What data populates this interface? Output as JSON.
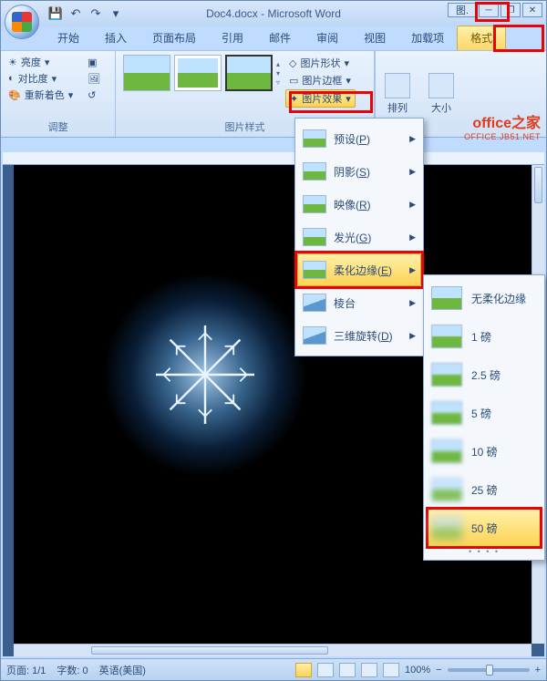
{
  "titlebar": {
    "doc_title": "Doc4.docx - Microsoft Word",
    "context_tab": "图."
  },
  "tabs": [
    "开始",
    "插入",
    "页面布局",
    "引用",
    "邮件",
    "审阅",
    "视图",
    "加载项",
    "格式"
  ],
  "ribbon": {
    "adjust": {
      "brightness": "亮度",
      "contrast": "对比度",
      "recolor": "重新着色",
      "label": "调整"
    },
    "styles": {
      "shape": "图片形状",
      "border": "图片边框",
      "effects": "图片效果",
      "label": "图片样式"
    },
    "arrange": {
      "label": "排列"
    },
    "size": {
      "label": "大小"
    }
  },
  "fx_menu": {
    "preset": "预设(P)",
    "shadow": "阴影(S)",
    "reflection": "映像(R)",
    "glow": "发光(G)",
    "softedge": "柔化边缘(E)",
    "bevel": "棱台",
    "rotation3d": "三维旋转(D)"
  },
  "soft_menu": {
    "none": "无柔化边缘",
    "p1": "1 磅",
    "p25": "2.5 磅",
    "p5": "5 磅",
    "p10": "10 磅",
    "p25b": "25 磅",
    "p50": "50 磅"
  },
  "watermark": {
    "line1": "office之家",
    "line2": "OFFICE.JB51.NET"
  },
  "statusbar": {
    "page": "页面: 1/1",
    "words": "字数: 0",
    "lang": "英语(美国)",
    "zoom": "100%"
  }
}
